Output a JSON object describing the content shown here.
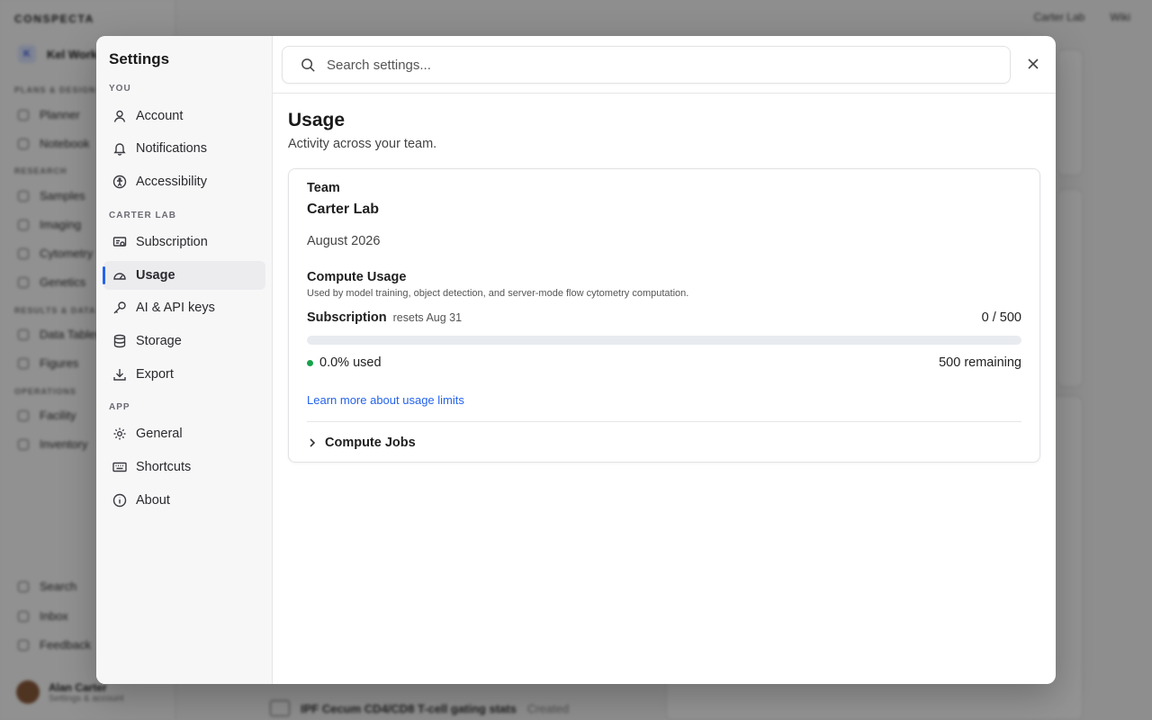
{
  "background": {
    "brand": "CONSPECTA",
    "workspace": {
      "badge": "K",
      "name": "Kel Work"
    },
    "sections": [
      "PLANS & DESIGN",
      "RESEARCH",
      "RESULTS & DATA",
      "OPERATIONS"
    ],
    "items": [
      "Planner",
      "Notebook",
      "Samples",
      "Imaging",
      "Cytometry",
      "Genetics",
      "Data Tables",
      "Figures",
      "Facility",
      "Inventory"
    ],
    "bottom_items": [
      "Search",
      "Inbox",
      "Feedback"
    ],
    "user": {
      "name": "Alan Carter",
      "sub": "Settings & account"
    },
    "topbar": [
      "Carter Lab",
      "Wiki"
    ],
    "bottom_row": {
      "title": "IPF Cecum CD4/CD8 T-cell gating stats",
      "status": "Created"
    }
  },
  "settings": {
    "title": "Settings",
    "groups": [
      {
        "label": "YOU",
        "items": [
          {
            "label": "Account",
            "icon": "user-icon"
          },
          {
            "label": "Notifications",
            "icon": "bell-icon"
          },
          {
            "label": "Accessibility",
            "icon": "accessibility-icon"
          }
        ]
      },
      {
        "label": "CARTER LAB",
        "items": [
          {
            "label": "Subscription",
            "icon": "subscription-icon"
          },
          {
            "label": "Usage",
            "icon": "gauge-icon",
            "active": true
          },
          {
            "label": "AI & API keys",
            "icon": "key-icon"
          },
          {
            "label": "Storage",
            "icon": "database-icon"
          },
          {
            "label": "Export",
            "icon": "download-icon"
          }
        ]
      },
      {
        "label": "APP",
        "items": [
          {
            "label": "General",
            "icon": "gear-icon"
          },
          {
            "label": "Shortcuts",
            "icon": "keyboard-icon"
          },
          {
            "label": "About",
            "icon": "info-icon"
          }
        ]
      }
    ],
    "search": {
      "placeholder": "Search settings..."
    },
    "page": {
      "title": "Usage",
      "subtitle": "Activity across your team.",
      "card": {
        "team_label": "Team",
        "team_name": "Carter Lab",
        "month": "August 2026",
        "compute_title": "Compute Usage",
        "compute_desc": "Used by model training, object detection, and server-mode flow cytometry computation.",
        "subscription_label": "Subscription",
        "resets": "resets Aug 31",
        "count": "0 / 500",
        "progress_fraction": 0.0,
        "used": "0.0% used",
        "remaining": "500 remaining",
        "learn_more": "Learn more about usage limits",
        "jobs": "Compute Jobs"
      }
    },
    "colors": {
      "accent": "#2563eb",
      "status_ok": "#16a34a"
    }
  }
}
